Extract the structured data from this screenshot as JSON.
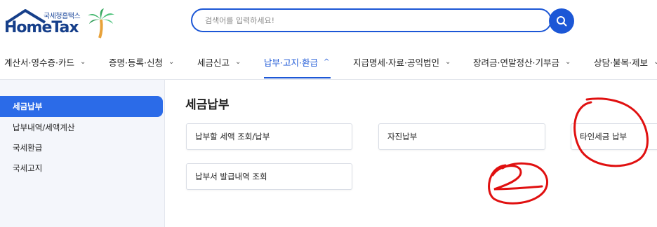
{
  "logo": {
    "sub_text": "국세청홈택스",
    "main_text": "HomeTax"
  },
  "search": {
    "placeholder": "검색어를 입력하세요!",
    "value": ""
  },
  "nav": {
    "items": [
      {
        "label": "계산서·영수증·카드",
        "icon": "chevron-down-icon",
        "glyph": "⌄"
      },
      {
        "label": "증명·등록·신청",
        "icon": "chevron-down-icon",
        "glyph": "⌄"
      },
      {
        "label": "세금신고",
        "icon": "chevron-down-icon",
        "glyph": "⌄"
      },
      {
        "label": "납부·고지·환급",
        "icon": "chevron-up-icon",
        "glyph": "^"
      },
      {
        "label": "지급명세·자료·공익법인",
        "icon": "chevron-down-icon",
        "glyph": "⌄"
      },
      {
        "label": "장려금·연말정산·기부금",
        "icon": "chevron-down-icon",
        "glyph": "⌄"
      },
      {
        "label": "상담·불복·제보",
        "icon": "chevron-down-icon",
        "glyph": "⌄"
      }
    ],
    "active_index": 3
  },
  "sidebar": {
    "items": [
      {
        "label": "세금납부",
        "active": true
      },
      {
        "label": "납부내역/세액계산",
        "active": false
      },
      {
        "label": "국세환급",
        "active": false
      },
      {
        "label": "국세고지",
        "active": false
      }
    ]
  },
  "main": {
    "title": "세금납부",
    "cards": [
      {
        "label": "납부할 세액 조회/납부"
      },
      {
        "label": "자진납부"
      },
      {
        "label": "타인세금 납부"
      },
      {
        "label": "납부서 발급내역 조회"
      }
    ]
  },
  "annotation": {
    "text": "2",
    "color": "#e01010"
  },
  "colors": {
    "accent": "#1c57d6",
    "sidebar_active": "#2b6be8",
    "brand_dark": "#163f8a",
    "annotation": "#e01010"
  }
}
